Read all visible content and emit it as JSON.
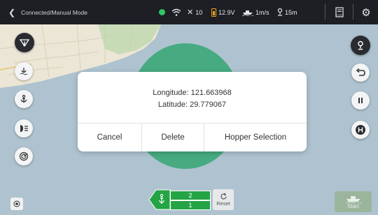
{
  "status_bar": {
    "back_icon": "chevron-left-icon",
    "mode": "Connected/Manual Mode",
    "connection_color": "#2ec566",
    "satellites": "10",
    "voltage": "12.9V",
    "speed": "1m/s",
    "depth": "15m"
  },
  "dialog": {
    "longitude": "Longitude: 121.663968",
    "latitude": "Latitude: 29.779067",
    "actions": [
      "Cancel",
      "Delete",
      "Hopper Selection"
    ]
  },
  "hopper": {
    "top": "2",
    "bottom": "1"
  },
  "reset_label": "Reset",
  "start_label": "Start",
  "colors": {
    "accent_green": "#24a444",
    "circle": "#3ea879",
    "status_bar": "#1d1f24"
  }
}
